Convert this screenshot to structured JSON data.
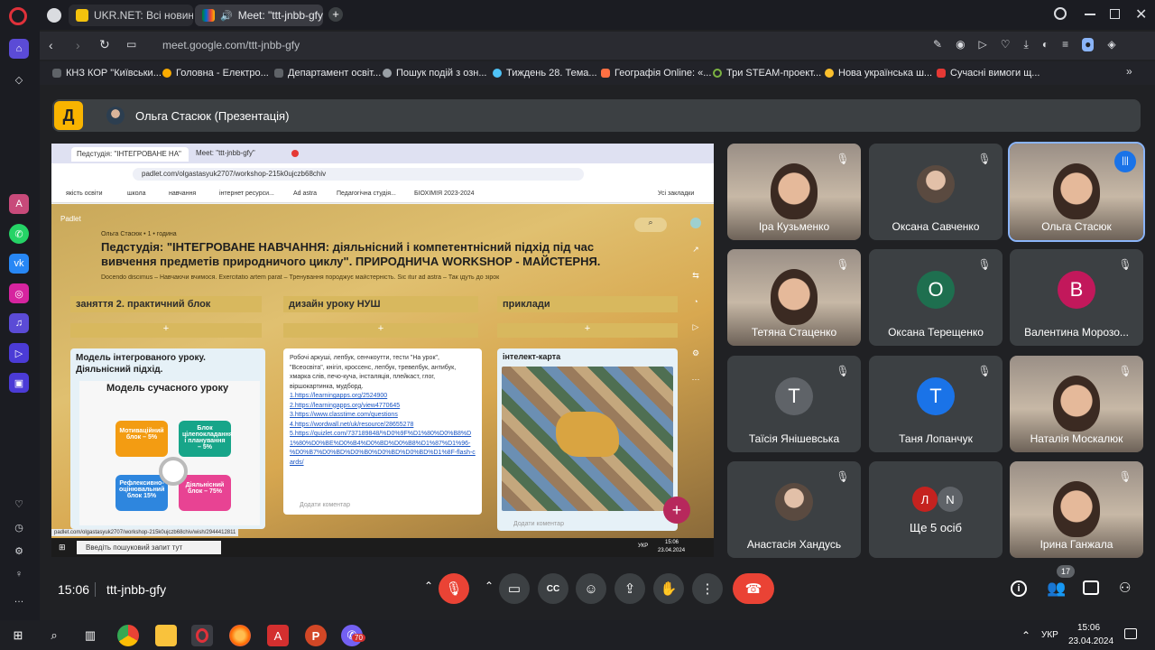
{
  "browser": {
    "tabs": [
      {
        "label": "UKR.NET: Всі новини Укр",
        "active": false
      },
      {
        "label": "Meet: \"ttt-jnbb-gfy\"",
        "active": true
      }
    ],
    "url": "meet.google.com/ttt-jnbb-gfy",
    "bookmarks": [
      "КНЗ КОР \"Київськи...",
      "Головна - Електро...",
      "Департамент освіт...",
      "Пошук подій з озн...",
      "Тиждень 28. Тема...",
      "Географія Online: «...",
      "Три STEAM-проект...",
      "Нова українська ш...",
      "Сучасні вимоги щ..."
    ]
  },
  "meet": {
    "presenter": "Ольга Стасюк (Презентація)",
    "logo_letter": "Д",
    "time": "15:06",
    "meeting_code": "ttt-jnbb-gfy",
    "participants_count": "17",
    "participants": [
      {
        "name": "Іра Кузьменко",
        "kind": "video"
      },
      {
        "name": "Оксана Савченко",
        "kind": "photo"
      },
      {
        "name": "Ольга Стасюк",
        "kind": "video",
        "speaking": true
      },
      {
        "name": "Тетяна Стаценко",
        "kind": "video"
      },
      {
        "name": "Оксана Терещенко",
        "kind": "letter",
        "letter": "О",
        "color": "#1e6f4f"
      },
      {
        "name": "Валентина Морозо...",
        "kind": "letter",
        "letter": "В",
        "color": "#c2185b"
      },
      {
        "name": "Таїсія Янішевська",
        "kind": "letter",
        "letter": "Т",
        "color": "#5f6368"
      },
      {
        "name": "Таня Лопанчук",
        "kind": "letter",
        "letter": "Т",
        "color": "#1a73e8"
      },
      {
        "name": "Наталія Москалюк",
        "kind": "video"
      },
      {
        "name": "Анастасія Хандусь",
        "kind": "photo"
      },
      {
        "name": "Ще 5 осіб",
        "kind": "more",
        "letters": [
          "Л",
          "N"
        ]
      },
      {
        "name": "Ірина Ганжала",
        "kind": "video"
      }
    ]
  },
  "shared": {
    "tabs": [
      "Педстудія: \"ІНТЕГРОВАНЕ НА\"",
      "Meet: \"ttt-jnbb-gfy\""
    ],
    "url": "padlet.com/olgastasyuk2707/workshop-215k0ujczb68chiv",
    "bookmarks": [
      "якість освіти",
      "школа",
      "навчання",
      "інтернет ресурси...",
      "Ad astra",
      "Педагогічна студія...",
      "БІОХІМІЯ 2023-2024",
      "Усі закладки"
    ],
    "padlet_brand": "Padlet",
    "author": "Ольга Стасюк • 1 • година",
    "title": "Педстудія: \"ІНТЕГРОВАНЕ НАВЧАННЯ: діяльнісний і компетентнісний підхід під час вивчення предметів природничого циклу\". ПРИРОДНИЧА WORKSHOP - МАЙСТЕРНЯ.",
    "subtitle": "Docendo discimus – Навчаючи вчимося. Exercitatio artem parat – Тренування породжує майстерність. Sic itur ad astra – Так ідуть до зірок",
    "columns": [
      {
        "header": "заняття 2. практичний блок",
        "card_title": "Модель інтегрованого уроку. Діяльнісний підхід.",
        "inner_title": "Модель сучасного уроку",
        "blocks": [
          "Мотиваційний блок – 5%",
          "Блок цілепокладання і планування – 5%",
          "Рефлексивно-оцінювальний блок 15%",
          "Діяльнісний блок – 75%"
        ]
      },
      {
        "header": "дизайн уроку НУШ",
        "text": "Робочі аркуші, лепбук, сенчкоутти, тести \"На урок\", \"Всеосвіта\", кнігіл, кроссенс, лепбук, тревелбук, антибук, хмарка слів, печо-куча, інсталяція, плейкаст, глог, віршокартинка, мудборд.",
        "links": [
          "1.https://learningapps.org/2524900",
          "2.https://learningapps.org/view4770645",
          "3.https://www.classtime.com/questions",
          "4.https://wordwall.net/uk/resource/28655278",
          "5.https://quizlet.com/737189848/%D0%9F%D1%80%D0%B8%D1%80%D0%BE%D0%B4%D0%BD%D0%B8%D1%87%D1%96-%D0%B7%D0%BD%D0%B0%D0%BD%D0%BD%D1%8F-flash-cards/"
        ],
        "comment": "Додати коментар"
      },
      {
        "header": "приклади",
        "card_title": "інтелект-карта",
        "comment": "Додати коментар"
      }
    ],
    "status_url": "padlet.com/olgastasyuk2707/workshop-215k0ujczb68chiv/wish/2944412811",
    "search_placeholder": "Введіть пошуковий запит тут",
    "lang": "УКР",
    "clock_time": "15:06",
    "clock_date": "23.04.2024"
  },
  "taskbar": {
    "lang": "УКР",
    "time": "15:06",
    "date": "23.04.2024",
    "badge": "70"
  }
}
